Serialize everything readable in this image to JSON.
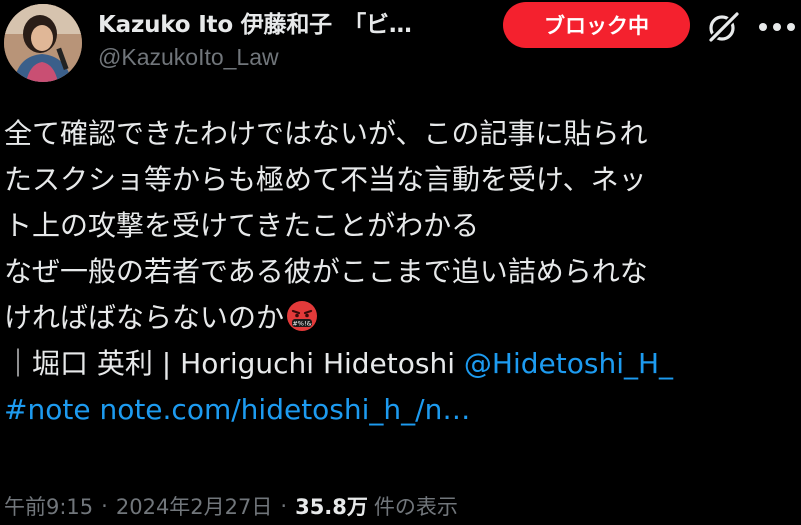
{
  "header": {
    "display_name": "Kazuko Ito 伊藤和子　「ビ…",
    "handle": "@KazukoIto_Law",
    "block_button_label": "ブロック中"
  },
  "tweet": {
    "lines": [
      "全て確認できたわけではないが、この記事に貼られ",
      "たスクショ等からも極めて不当な言動を受け、ネッ",
      "ト上の攻撃を受けてきたことがわかる",
      "なぜ一般の若者である彼がここまで追い詰められな",
      "ければばならないのか"
    ],
    "quote_line_text": "｜堀口 英利 | Horiguchi Hidetoshi ",
    "mention": "@Hidetoshi_H_",
    "hashtag": "#note",
    "link": "note.com/hidetoshi_h_/n…"
  },
  "meta": {
    "time": "午前9:15",
    "date": "2024年2月27日",
    "views_count": "35.8万",
    "views_label": "件の表示"
  },
  "colors": {
    "background": "#000000",
    "text": "#e7e9ea",
    "secondary": "#71767b",
    "link": "#1d9bf0",
    "block_red": "#f4212e"
  },
  "icons": {
    "avatar": "profile-photo",
    "grok": "grok-icon",
    "more": "more-icon",
    "emoji": "face-with-symbols-on-mouth"
  }
}
